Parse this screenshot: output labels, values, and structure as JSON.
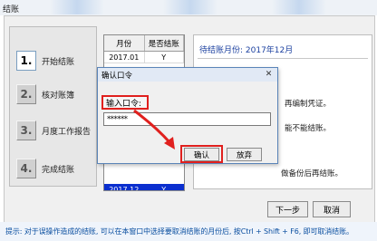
{
  "window": {
    "title": "结账"
  },
  "steps": [
    {
      "num": "1.",
      "label": "开始结账",
      "active": true
    },
    {
      "num": "2.",
      "label": "核对账簿",
      "active": false
    },
    {
      "num": "3.",
      "label": "月度工作报告",
      "active": false
    },
    {
      "num": "4.",
      "label": "完成结账",
      "active": false
    }
  ],
  "table": {
    "headers": [
      "月份",
      "是否结账"
    ],
    "first_row": [
      "2017.01",
      "Y"
    ],
    "selected_row": [
      "2017.12",
      "Y"
    ]
  },
  "info": {
    "waiting_label": "待结账月份: 2017年12月",
    "line1": "再编制凭证。",
    "line2": "能不能结账。",
    "line3": "做备份后再结账。"
  },
  "buttons": {
    "next": "下一步",
    "cancel": "取消"
  },
  "tip": "提示: 对于误操作造成的结账, 可以在本窗口中选择要取消结账的月份后, 按Ctrl + Shift + F6, 即可取消结账。",
  "dialog": {
    "title": "确认口令",
    "close": "✕",
    "password_label": "输入口令:",
    "password_value": "******",
    "ok": "确认",
    "cancel": "放弃"
  },
  "colors": {
    "highlight": "#e0201e",
    "selected_row": "#0b2fcf",
    "tip_text": "#0b4fa0"
  }
}
